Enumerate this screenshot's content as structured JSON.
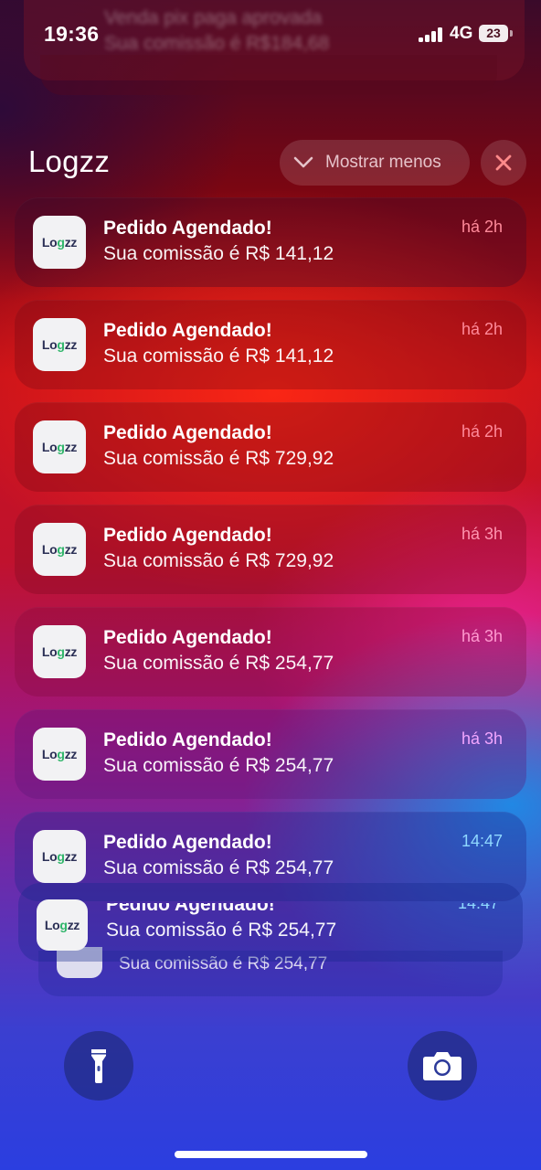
{
  "status_bar": {
    "time": "19:36",
    "network": "4G",
    "battery": "23"
  },
  "ghost_notification": {
    "title": "Venda pix paga aprovada",
    "body": "Sua comissão é R$184,68"
  },
  "group": {
    "app_name": "Logzz",
    "show_less_label": "Mostrar menos"
  },
  "app_icon_text": {
    "part1": "Lo",
    "part2": "g",
    "part3": "zz"
  },
  "notifications": [
    {
      "title": "Pedido Agendado!",
      "body": "Sua comissão é R$ 141,12",
      "time": "há 2h",
      "time_color": "#ff8a9a"
    },
    {
      "title": "Pedido Agendado!",
      "body": "Sua comissão é R$ 141,12",
      "time": "há 2h",
      "time_color": "#ff8a9a"
    },
    {
      "title": "Pedido Agendado!",
      "body": "Sua comissão é R$ 729,92",
      "time": "há 2h",
      "time_color": "#ff8a9a"
    },
    {
      "title": "Pedido Agendado!",
      "body": "Sua comissão é R$ 729,92",
      "time": "há 3h",
      "time_color": "#ff95b0"
    },
    {
      "title": "Pedido Agendado!",
      "body": "Sua comissão é R$ 254,77",
      "time": "há 3h",
      "time_color": "#ff9ad0"
    },
    {
      "title": "Pedido Agendado!",
      "body": "Sua comissão é R$ 254,77",
      "time": "há 3h",
      "time_color": "#f2a6ff"
    },
    {
      "title": "Pedido Agendado!",
      "body": "Sua comissão é R$ 254,77",
      "time": "14:47",
      "time_color": "#8fd8ff"
    }
  ],
  "stacked": [
    {
      "title": "Pedido Agendado!",
      "body": "Sua comissão é R$ 254,77",
      "time": "14:47"
    },
    {
      "body": "Sua comissão é R$ 254,77"
    }
  ],
  "icons": {
    "flashlight": "flashlight-icon",
    "camera": "camera-icon",
    "close": "close-icon",
    "chevron": "chevron-down-icon"
  }
}
